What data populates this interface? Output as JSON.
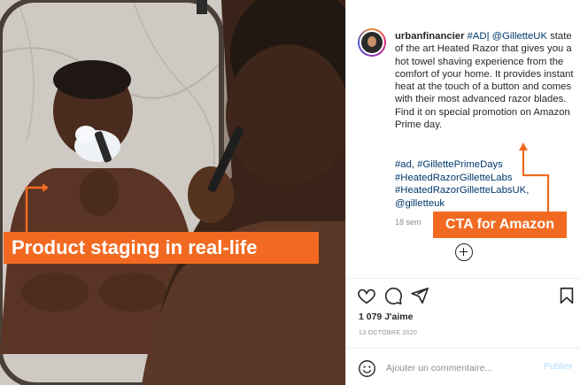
{
  "post": {
    "username": "urbanfinancier",
    "caption_hashtag_ad": "#AD|",
    "caption_mention": "@GilletteUK",
    "caption_body": "state of the art Heated Razor that gives you a hot towel shaving experience from the comfort of your home. It provides instant heat at the touch of a button and comes with their most advanced razor blades. Find it on special promotion on Amazon Prime day.",
    "hashtags": [
      "#ad, #GillettePrimeDays",
      "#HeatedRazorGilletteLabs",
      "#HeatedRazorGilletteLabsUK,",
      "@gilletteuk"
    ],
    "time_ago": "18 sem",
    "likes": "1 079 J'aime",
    "date": "13 OCTOBRE 2020"
  },
  "comment": {
    "placeholder": "Ajouter un commentaire...",
    "publish_label": "Publier"
  },
  "annotations": {
    "left_callout": "Product staging in real-life",
    "right_callout": "CTA for Amazon"
  },
  "icons": {
    "like": "heart-icon",
    "comment": "comment-icon",
    "share": "share-icon",
    "save": "bookmark-icon",
    "emoji": "emoji-icon",
    "load_more": "plus-circle-icon"
  },
  "colors": {
    "callout_orange": "#f26a21",
    "link_blue": "#00376b",
    "muted_gray": "#8e8e8e",
    "publish_disabled": "#b2dffc"
  }
}
